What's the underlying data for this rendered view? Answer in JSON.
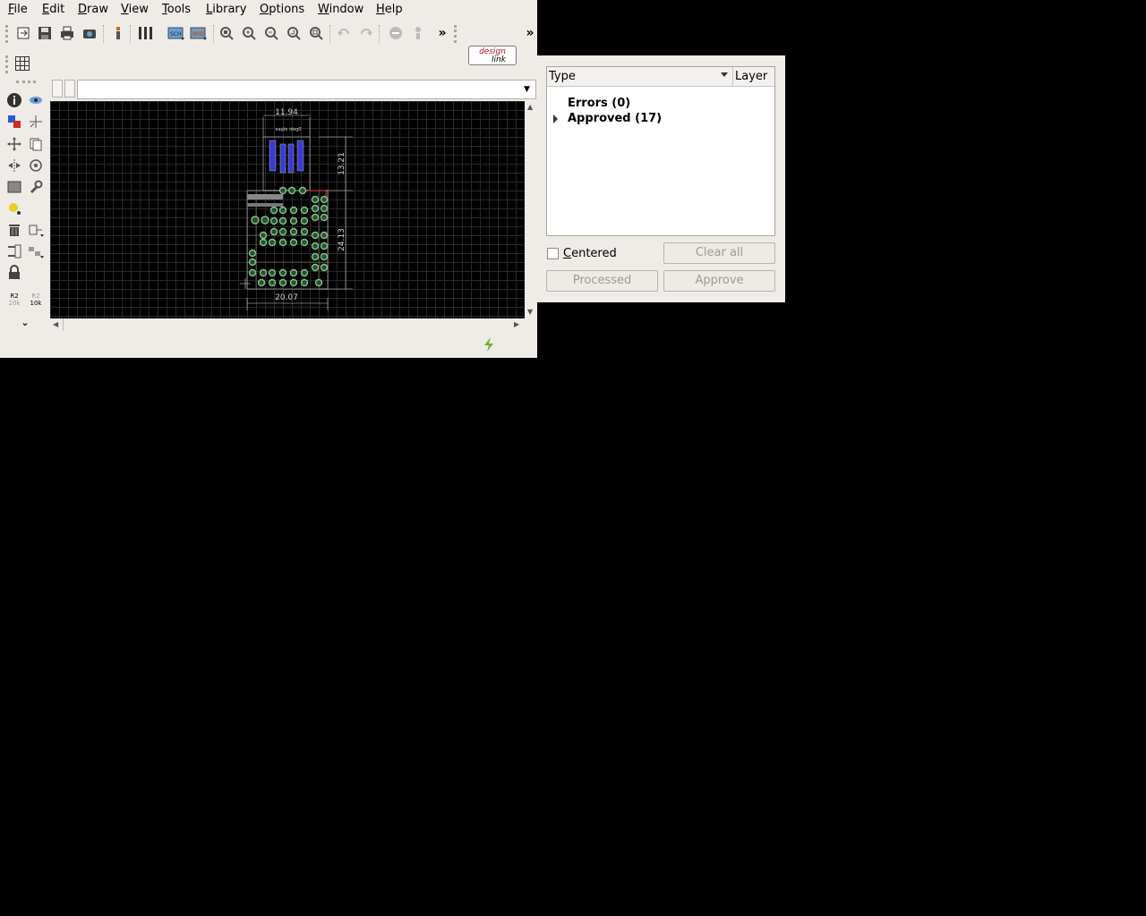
{
  "menubar": {
    "items": [
      {
        "label": "File",
        "accel": "F",
        "rest": "ile"
      },
      {
        "label": "Edit",
        "accel": "E",
        "rest": "dit"
      },
      {
        "label": "Draw",
        "accel": "D",
        "rest": "raw"
      },
      {
        "label": "View",
        "accel": "V",
        "rest": "iew"
      },
      {
        "label": "Tools",
        "accel": "T",
        "rest": "ools"
      },
      {
        "label": "Library",
        "accel": "L",
        "rest": "ibrary"
      },
      {
        "label": "Options",
        "accel": "O",
        "rest": "ptions"
      },
      {
        "label": "Window",
        "accel": "W",
        "rest": "indow"
      },
      {
        "label": "Help",
        "accel": "H",
        "rest": "elp"
      }
    ]
  },
  "toolbar": {
    "designlink_line1": "design",
    "designlink_line2": "link",
    "overflow": "»"
  },
  "board": {
    "dim_top": "11.94",
    "dim_right_upper": "13.21",
    "dim_right_lower": "24.13",
    "dim_bottom": "20.07",
    "silk_text": "eagle dwg0"
  },
  "sidebar_tool_labels": {
    "name_tool": "R2",
    "value_tool": "10k"
  },
  "drc": {
    "column_type": "Type",
    "column_layer": "Layer",
    "rows": [
      {
        "label": "Errors (0)",
        "expandable": false
      },
      {
        "label": "Approved (17)",
        "expandable": true
      }
    ],
    "centered_accel": "C",
    "centered_rest": "entered",
    "centered_checked": false,
    "buttons": {
      "clear_all": "Clear all",
      "processed": "Processed",
      "approve": "Approve"
    }
  },
  "colors": {
    "window_bg": "#efebe7",
    "desktop_bg": "#000000",
    "canvas_bg": "#000000",
    "grid": "#2a2a2a",
    "pad_green": "#7fc48a",
    "smd_blue": "#3b3bd1",
    "status_icon_green": "#6ab03b"
  }
}
